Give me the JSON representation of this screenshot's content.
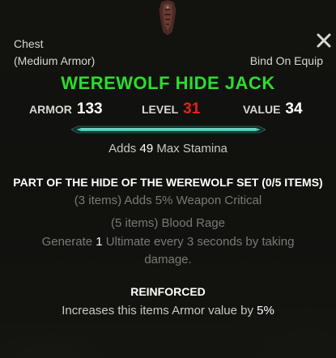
{
  "item": {
    "slot": "Chest",
    "weight": "(Medium Armor)",
    "bind": "Bind On Equip",
    "name": "WEREWOLF HIDE JACK",
    "name_color": "#2ddc2d",
    "icon": "chest-armor-icon"
  },
  "stats": {
    "armor_label": "ARMOR",
    "armor_value": "133",
    "level_label": "LEVEL",
    "level_value": "31",
    "value_label": "VALUE",
    "value_value": "34"
  },
  "enchant": {
    "prefix": "Adds",
    "amount": "49",
    "suffix": "Max Stamina"
  },
  "set": {
    "title": "PART OF THE HIDE OF THE WEREWOLF SET (0/5 ITEMS)",
    "bonus_3": "(3 items) Adds 5% Weapon Critical",
    "bonus_5_title": "(5 items) Blood Rage",
    "bonus_5_line1_prefix": "Generate",
    "bonus_5_line1_amount": "1",
    "bonus_5_line1_suffix": "Ultimate every 3 seconds by taking",
    "bonus_5_line2": "damage."
  },
  "trait": {
    "title": "REINFORCED",
    "desc_prefix": "Increases this items Armor value by",
    "desc_amount": "5%"
  },
  "controls": {
    "close_icon": "close-icon"
  }
}
